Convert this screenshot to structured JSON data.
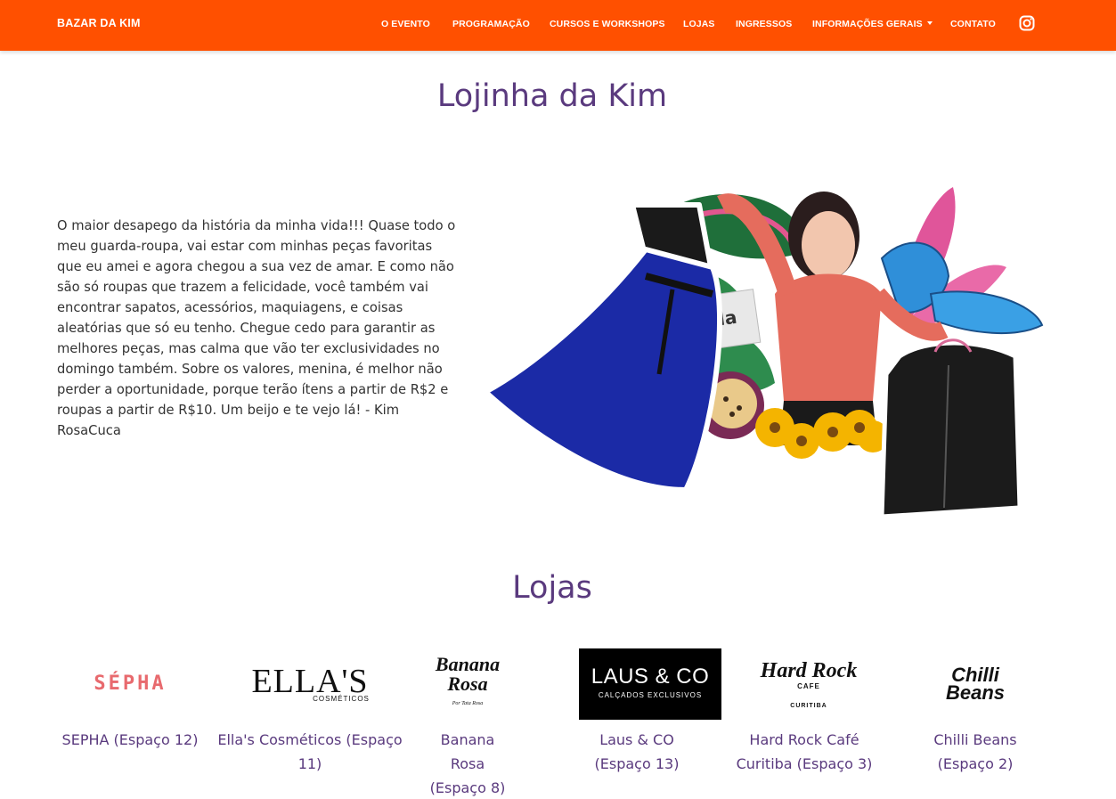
{
  "navbar": {
    "brand": "BAZAR DA KIM",
    "items": [
      {
        "label": "O EVENTO"
      },
      {
        "label": "PROGRAMAÇÃO"
      },
      {
        "label": "CURSOS E WORKSHOPS"
      },
      {
        "label": "LOJAS"
      },
      {
        "label": "INGRESSOS"
      },
      {
        "label": "INFORMAÇÕES GERAIS"
      },
      {
        "label": "CONTATO"
      }
    ],
    "instagram_icon": "instagram-icon",
    "background_color": "#ff5000"
  },
  "intro": {
    "title": "Lojinha da Kim",
    "text": "O maior desapego da história da minha vida!!! Quase todo o meu guarda-roupa, vai estar com minhas peças favoritas que eu amei e agora chegou a sua vez de amar. E como não são só roupas que trazem a felicidade, você também vai encontrar sapatos, acessórios, maquiagens, e coisas aleatórias que só eu tenho. Chegue cedo para garantir as melhores peças, mas calma que vão ter exclusividades no domingo também. Sobre os valores, menina, é melhor não perder a oportunidade, porque terão ítens a partir de R$2 e roupas a partir de R$10. Um beijo e te vejo lá! - Kim RosaCuca",
    "collage_text": "Toda"
  },
  "stores": {
    "title": "Lojas",
    "items": [
      {
        "name": "SEPHA (Espaço 12)",
        "logo_text": "SÉPHA"
      },
      {
        "name": "Ella's Cosméticos (Espaço 11)",
        "logo_text": "ELLA'S",
        "logo_subtext": "COSMÉTICOS"
      },
      {
        "name": "Banana Rosa (Espaço 8)",
        "logo_text": "Banana Rosa",
        "logo_subtext": "Por Tata Rosa"
      },
      {
        "name": "Laus & CO (Espaço 13)",
        "logo_text": "LAUS & CO",
        "logo_subtext": "CALÇADOS EXCLUSIVOS"
      },
      {
        "name": "Hard Rock Café Curitiba (Espaço 3)",
        "logo_text": "Hard Rock",
        "logo_mid": "CAFE",
        "logo_subtext": "CURITIBA"
      },
      {
        "name": "Chilli Beans (Espaço 2)",
        "logo_text": "Chilli",
        "logo_text2": "Beans"
      }
    ]
  },
  "colors": {
    "accent": "#ff5000",
    "heading": "#5a3a7e"
  }
}
